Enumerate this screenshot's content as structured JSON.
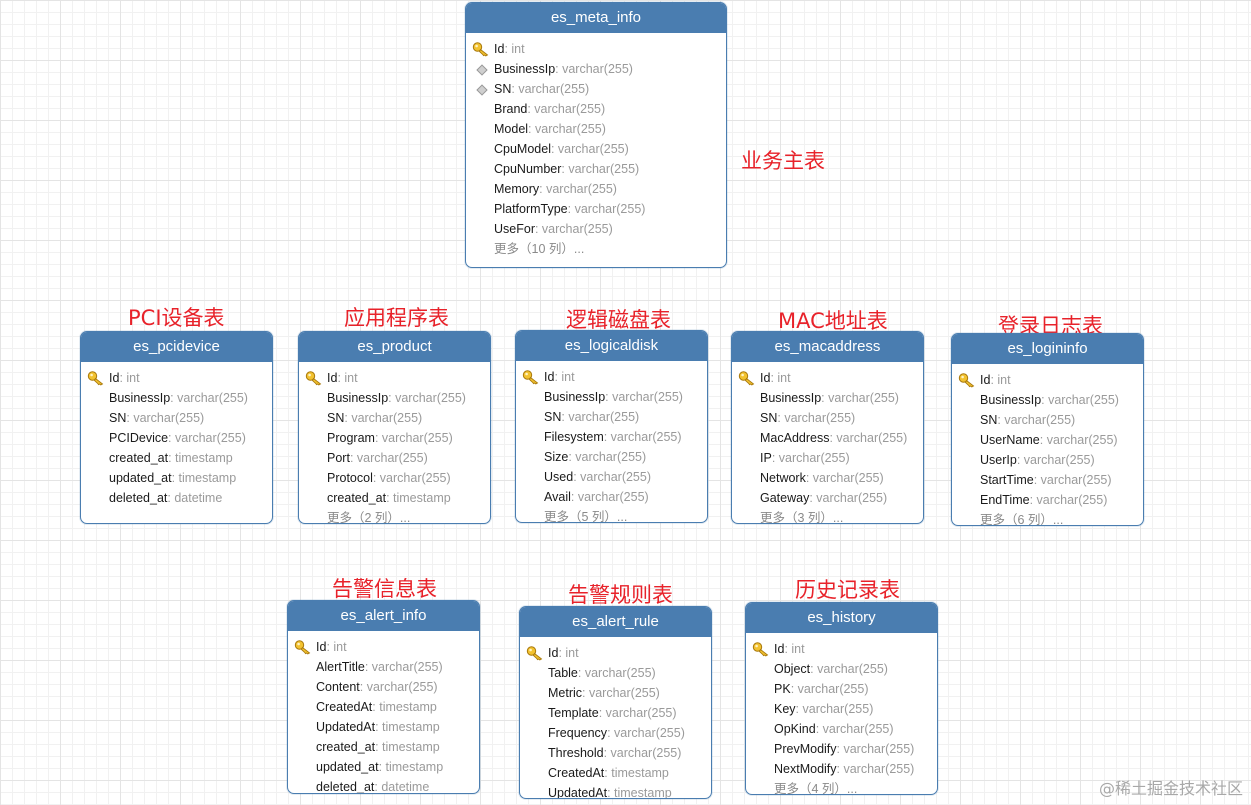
{
  "colors": {
    "header": "#4a7db0",
    "caption": "#e8222a",
    "type_text": "#9a9a9a"
  },
  "captions": {
    "meta": "业务主表",
    "pcidevice": "PCI设备表",
    "product": "应用程序表",
    "logicaldisk": "逻辑磁盘表",
    "macaddress": "MAC地址表",
    "logininfo": "登录日志表",
    "alert_info": "告警信息表",
    "alert_rule": "告警规则表",
    "history": "历史记录表"
  },
  "watermark": "@稀土掘金技术社区",
  "tables": {
    "meta": {
      "title": "es_meta_info",
      "fields": [
        {
          "name": "Id",
          "type": ": int",
          "icon": "primary-key-icon"
        },
        {
          "name": "BusinessIp",
          "type": ": varchar(255)",
          "icon": "index-icon"
        },
        {
          "name": "SN",
          "type": ": varchar(255)",
          "icon": "index-icon"
        },
        {
          "name": "Brand",
          "type": ": varchar(255)"
        },
        {
          "name": "Model",
          "type": ": varchar(255)"
        },
        {
          "name": "CpuModel",
          "type": ": varchar(255)"
        },
        {
          "name": "CpuNumber",
          "type": ": varchar(255)"
        },
        {
          "name": "Memory",
          "type": ": varchar(255)"
        },
        {
          "name": "PlatformType",
          "type": ": varchar(255)"
        },
        {
          "name": "UseFor",
          "type": ": varchar(255)"
        }
      ],
      "more": "更多（10 列）..."
    },
    "pcidevice": {
      "title": "es_pcidevice",
      "fields": [
        {
          "name": "Id",
          "type": ": int",
          "icon": "primary-key-icon"
        },
        {
          "name": "BusinessIp",
          "type": ": varchar(255)"
        },
        {
          "name": "SN",
          "type": ": varchar(255)"
        },
        {
          "name": "PCIDevice",
          "type": ": varchar(255)"
        },
        {
          "name": "created_at",
          "type": ": timestamp"
        },
        {
          "name": "updated_at",
          "type": ": timestamp"
        },
        {
          "name": "deleted_at",
          "type": ": datetime"
        }
      ],
      "more": ""
    },
    "product": {
      "title": "es_product",
      "fields": [
        {
          "name": "Id",
          "type": ": int",
          "icon": "primary-key-icon"
        },
        {
          "name": "BusinessIp",
          "type": ": varchar(255)"
        },
        {
          "name": "SN",
          "type": ": varchar(255)"
        },
        {
          "name": "Program",
          "type": ": varchar(255)"
        },
        {
          "name": "Port",
          "type": ": varchar(255)"
        },
        {
          "name": "Protocol",
          "type": ": varchar(255)"
        },
        {
          "name": "created_at",
          "type": ": timestamp"
        }
      ],
      "more": "更多（2 列）..."
    },
    "logicaldisk": {
      "title": "es_logicaldisk",
      "fields": [
        {
          "name": "Id",
          "type": ": int",
          "icon": "primary-key-icon"
        },
        {
          "name": "BusinessIp",
          "type": ": varchar(255)"
        },
        {
          "name": "SN",
          "type": ": varchar(255)"
        },
        {
          "name": "Filesystem",
          "type": ": varchar(255)"
        },
        {
          "name": "Size",
          "type": ": varchar(255)"
        },
        {
          "name": "Used",
          "type": ": varchar(255)"
        },
        {
          "name": "Avail",
          "type": ": varchar(255)"
        }
      ],
      "more": "更多（5 列）..."
    },
    "macaddress": {
      "title": "es_macaddress",
      "fields": [
        {
          "name": "Id",
          "type": ": int",
          "icon": "primary-key-icon"
        },
        {
          "name": "BusinessIp",
          "type": ": varchar(255)"
        },
        {
          "name": "SN",
          "type": ": varchar(255)"
        },
        {
          "name": "MacAddress",
          "type": ": varchar(255)"
        },
        {
          "name": "IP",
          "type": ": varchar(255)"
        },
        {
          "name": "Network",
          "type": ": varchar(255)"
        },
        {
          "name": "Gateway",
          "type": ": varchar(255)"
        }
      ],
      "more": "更多（3 列）..."
    },
    "logininfo": {
      "title": "es_logininfo",
      "fields": [
        {
          "name": "Id",
          "type": ": int",
          "icon": "primary-key-icon"
        },
        {
          "name": "BusinessIp",
          "type": ": varchar(255)"
        },
        {
          "name": "SN",
          "type": ": varchar(255)"
        },
        {
          "name": "UserName",
          "type": ": varchar(255)"
        },
        {
          "name": "UserIp",
          "type": ": varchar(255)"
        },
        {
          "name": "StartTime",
          "type": ": varchar(255)"
        },
        {
          "name": "EndTime",
          "type": ": varchar(255)"
        }
      ],
      "more": "更多（6 列）..."
    },
    "alert_info": {
      "title": "es_alert_info",
      "fields": [
        {
          "name": "Id",
          "type": ": int",
          "icon": "primary-key-icon"
        },
        {
          "name": "AlertTitle",
          "type": ": varchar(255)"
        },
        {
          "name": "Content",
          "type": ": varchar(255)"
        },
        {
          "name": "CreatedAt",
          "type": ": timestamp"
        },
        {
          "name": "UpdatedAt",
          "type": ": timestamp"
        },
        {
          "name": "created_at",
          "type": ": timestamp"
        },
        {
          "name": "updated_at",
          "type": ": timestamp"
        },
        {
          "name": "deleted_at",
          "type": ": datetime"
        }
      ],
      "more": ""
    },
    "alert_rule": {
      "title": "es_alert_rule",
      "fields": [
        {
          "name": "Id",
          "type": ": int",
          "icon": "primary-key-icon"
        },
        {
          "name": "Table",
          "type": ": varchar(255)"
        },
        {
          "name": "Metric",
          "type": ": varchar(255)"
        },
        {
          "name": "Template",
          "type": ": varchar(255)"
        },
        {
          "name": "Frequency",
          "type": ": varchar(255)"
        },
        {
          "name": "Threshold",
          "type": ": varchar(255)"
        },
        {
          "name": "CreatedAt",
          "type": ": timestamp"
        },
        {
          "name": "UpdatedAt",
          "type": ": timestamp"
        }
      ],
      "more": ""
    },
    "history": {
      "title": "es_history",
      "fields": [
        {
          "name": "Id",
          "type": ": int",
          "icon": "primary-key-icon"
        },
        {
          "name": "Object",
          "type": ": varchar(255)"
        },
        {
          "name": "PK",
          "type": ": varchar(255)"
        },
        {
          "name": "Key",
          "type": ": varchar(255)"
        },
        {
          "name": "OpKind",
          "type": ": varchar(255)"
        },
        {
          "name": "PrevModify",
          "type": ": varchar(255)"
        },
        {
          "name": "NextModify",
          "type": ": varchar(255)"
        }
      ],
      "more": "更多（4 列）..."
    }
  }
}
